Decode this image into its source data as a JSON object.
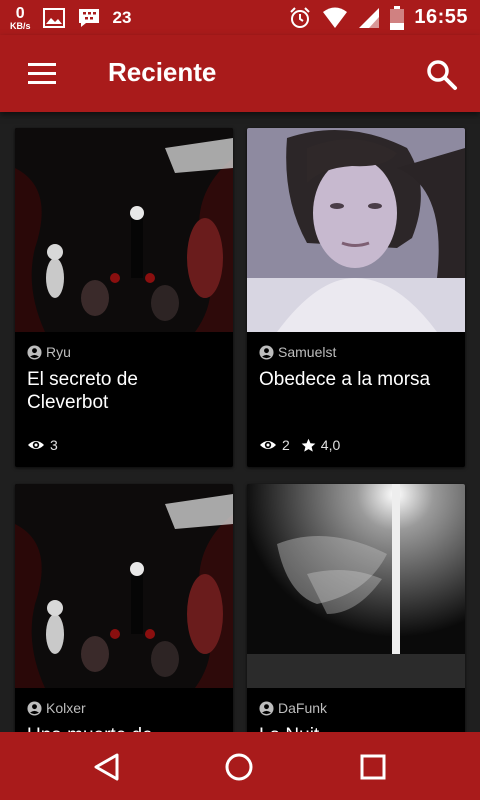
{
  "status_bar": {
    "speed_value": "0",
    "speed_unit": "KB/s",
    "notification_count": "23",
    "time": "16:55",
    "icons": [
      "image-icon",
      "bbm-icon",
      "alarm-icon",
      "wifi-icon",
      "cell-signal-icon",
      "battery-icon"
    ]
  },
  "app_bar": {
    "title": "Reciente",
    "icons": [
      "menu-icon",
      "search-icon"
    ]
  },
  "cards": [
    {
      "author": "Ryu",
      "title": "El secreto de Cleverbot",
      "views": "3",
      "rating": null
    },
    {
      "author": "Samuelst",
      "title": "Obedece a la morsa",
      "views": "2",
      "rating": "4,0"
    },
    {
      "author": "Kolxer",
      "title": "Una muerte de",
      "views": null,
      "rating": null
    },
    {
      "author": "DaFunk",
      "title": "La Nuit",
      "views": null,
      "rating": null
    }
  ],
  "nav_bar": {
    "icons": [
      "back-icon",
      "home-icon",
      "recents-icon"
    ]
  },
  "colors": {
    "primary": "#a91b1b",
    "background": "#1f1f1f",
    "card": "#000000",
    "muted_text": "#bdbdbd"
  }
}
